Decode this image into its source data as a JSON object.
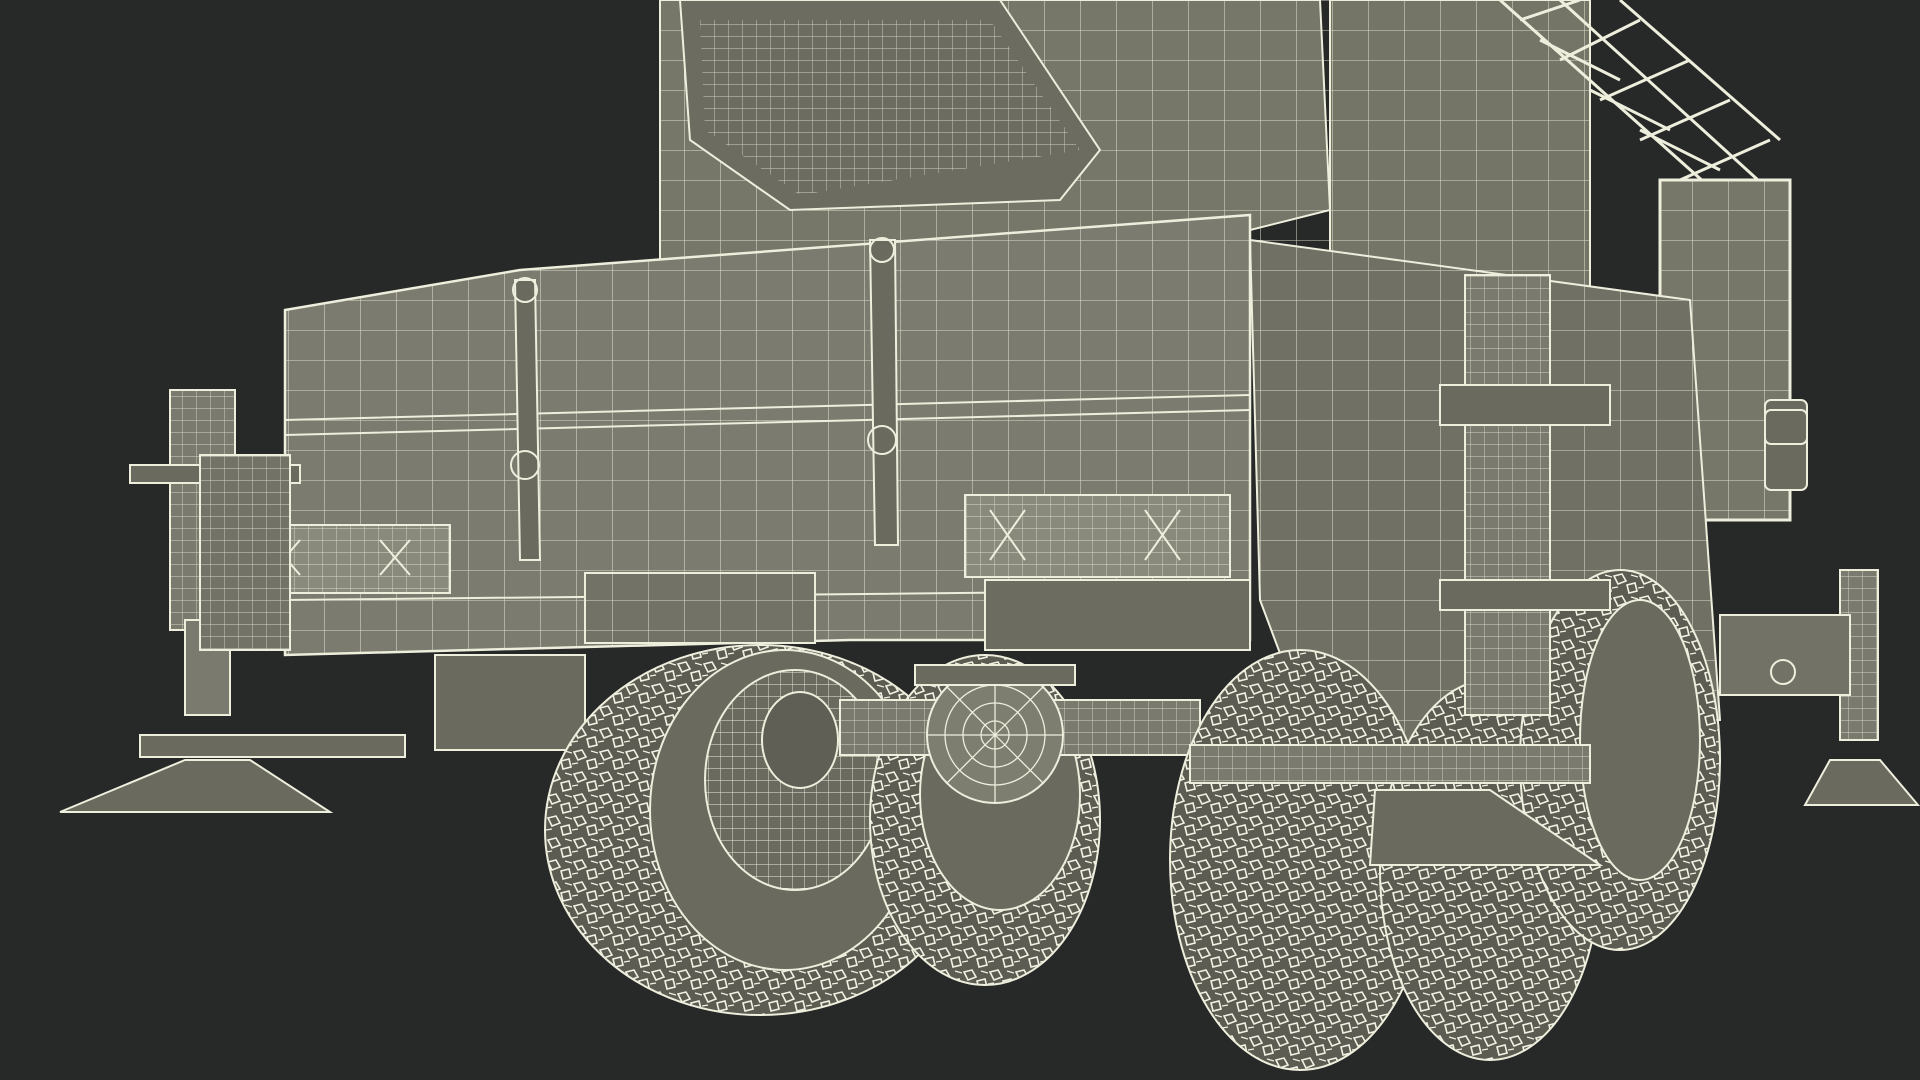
{
  "scene": {
    "subject": "wireframe-truck-rear",
    "colors": {
      "background": "#272828",
      "body_fill": "#7a7a6e",
      "body_fill_dark": "#6a6a5f",
      "wire": "#eeeedd",
      "tire": "#5c5c52",
      "tread": "#f2f2e4"
    }
  }
}
